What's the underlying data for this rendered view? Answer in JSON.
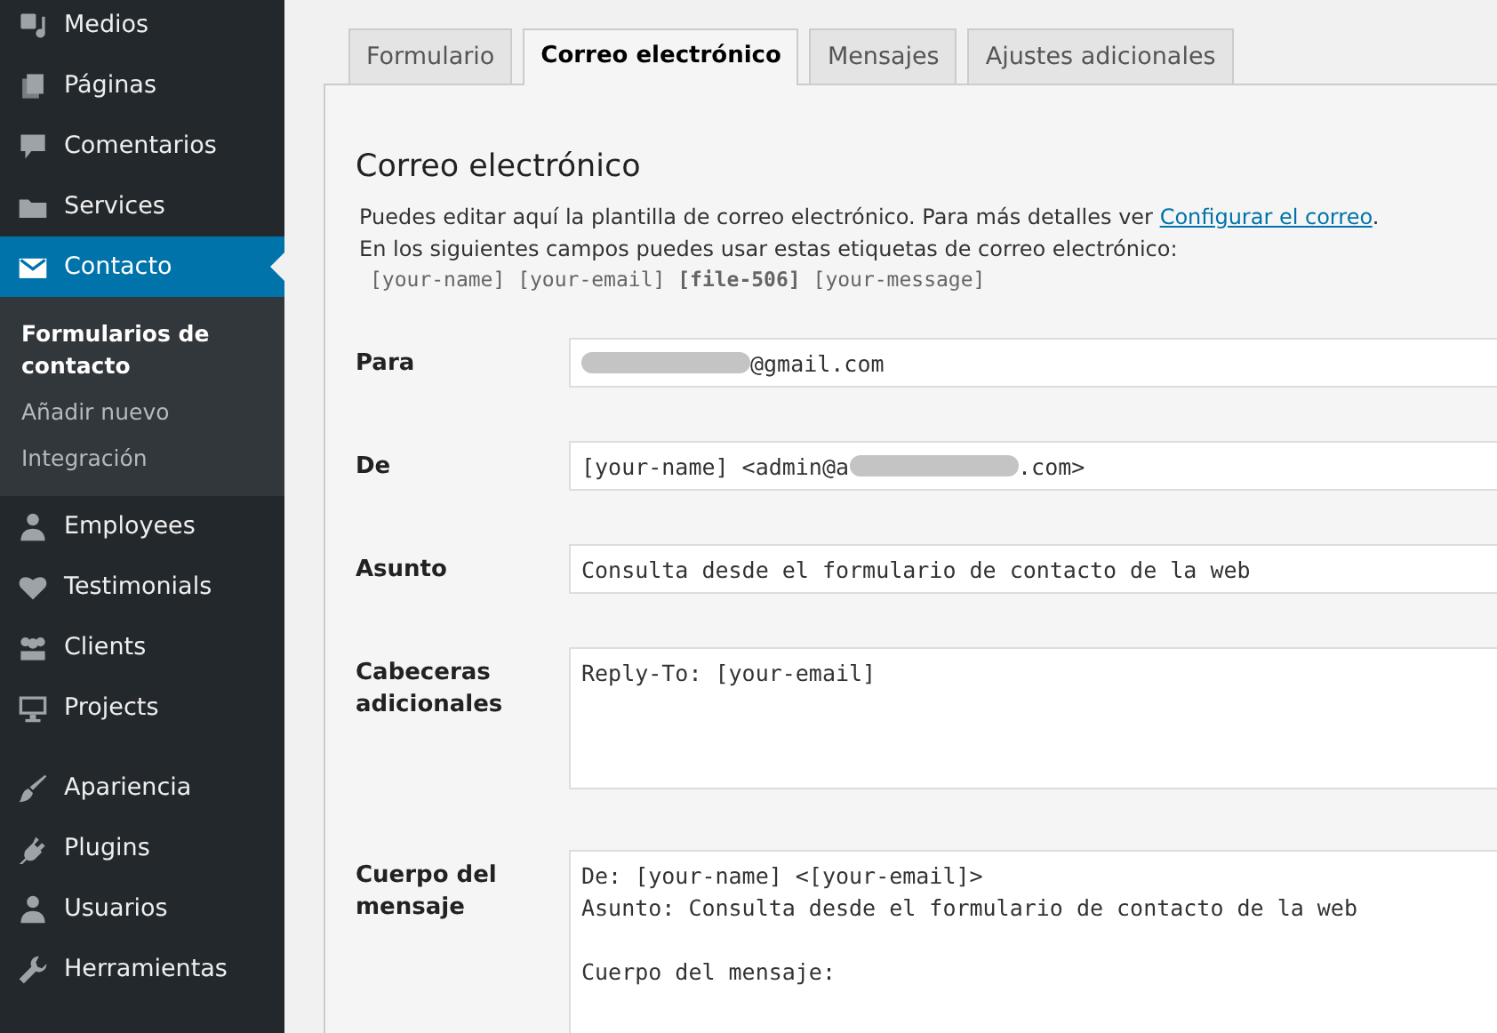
{
  "sidebar": {
    "items": [
      {
        "label": "Medios",
        "current": false
      },
      {
        "label": "Páginas",
        "current": false
      },
      {
        "label": "Comentarios",
        "current": false
      },
      {
        "label": "Services",
        "current": false
      },
      {
        "label": "Contacto",
        "current": true,
        "children": [
          {
            "label": "Formularios de contacto",
            "selected": true
          },
          {
            "label": "Añadir nuevo",
            "selected": false
          },
          {
            "label": "Integración",
            "selected": false
          }
        ]
      },
      {
        "label": "Employees",
        "current": false
      },
      {
        "label": "Testimonials",
        "current": false
      },
      {
        "label": "Clients",
        "current": false
      },
      {
        "label": "Projects",
        "current": false,
        "separator_after": true
      },
      {
        "label": "Apariencia",
        "current": false
      },
      {
        "label": "Plugins",
        "current": false
      },
      {
        "label": "Usuarios",
        "current": false
      },
      {
        "label": "Herramientas",
        "current": false
      }
    ]
  },
  "tabs": [
    {
      "label": "Formulario",
      "selected": false
    },
    {
      "label": "Correo electrónico",
      "selected": true
    },
    {
      "label": "Mensajes",
      "selected": false
    },
    {
      "label": "Ajustes adicionales",
      "selected": false
    }
  ],
  "panel": {
    "heading": "Correo electrónico",
    "description": {
      "text": "Puedes editar aquí la plantilla de correo electrónico. Para más detalles ver ",
      "link": "Configurar el correo",
      "after": "."
    },
    "tags_intro": "En los siguientes campos puedes usar estas etiquetas de correo electrónico:",
    "tags": "[your-name] [your-email] **[file-506]** [your-message]",
    "fields": [
      {
        "label": "Para",
        "kind": "line",
        "value": [
          {
            "kind": "redacted"
          },
          {
            "kind": "text",
            "text": "@gmail.com"
          }
        ]
      },
      {
        "label": "De",
        "kind": "line",
        "value": [
          {
            "kind": "text",
            "text": "[your-name] <admin@a"
          },
          {
            "kind": "redacted"
          },
          {
            "kind": "text",
            "text": ".com>"
          }
        ]
      },
      {
        "label": "Asunto",
        "kind": "line",
        "value": [
          {
            "kind": "text",
            "text": "Consulta desde el formulario de contacto de la web"
          }
        ]
      },
      {
        "label": "Cabeceras adicionales",
        "kind": "area",
        "value": "Reply-To: [your-email]"
      },
      {
        "label": "Cuerpo del mensaje",
        "kind": "area",
        "value": "De: [your-name] <[your-email]>\nAsunto: Consulta desde el formulario de contacto de la web\n\nCuerpo del mensaje:"
      }
    ]
  }
}
